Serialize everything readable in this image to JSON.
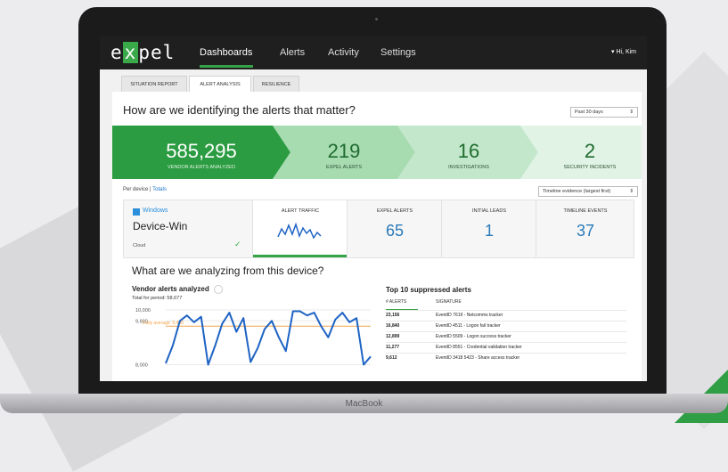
{
  "laptop_label": "MacBook",
  "app": {
    "logo_pre": "e",
    "logo_x": "x",
    "logo_post": "pel",
    "nav": [
      "Dashboards",
      "Alerts",
      "Activity",
      "Settings"
    ],
    "user": "▾ Hi, Kim"
  },
  "tabs": [
    "SITUATION REPORT",
    "ALERT ANALYSIS",
    "RESILIENCE"
  ],
  "question1": "How are we identifying the alerts that matter?",
  "range_select": "Past 30 days",
  "funnel": [
    {
      "value": "585,295",
      "label": "Vendor alerts analyzed"
    },
    {
      "value": "219",
      "label": "Expel alerts"
    },
    {
      "value": "16",
      "label": "Investigations"
    },
    {
      "value": "2",
      "label": "Security incidents"
    }
  ],
  "per_device": "Per device",
  "totals_link": "Totals",
  "sort_select": "Timeline evidence (largest first)",
  "device": {
    "brand": "Windows",
    "name": "Device-Win",
    "cloud": "Cloud",
    "columns": [
      {
        "label": "Alert traffic",
        "value": ""
      },
      {
        "label": "Expel alerts",
        "value": "65"
      },
      {
        "label": "Initial leads",
        "value": "1"
      },
      {
        "label": "Timeline events",
        "value": "37"
      }
    ]
  },
  "question2": "What are we analyzing from this device?",
  "chart_title": "Vendor alerts analyzed",
  "chart_subtitle": "Total for period: 58,677",
  "chart_data": {
    "type": "line",
    "title": "Vendor alerts analyzed",
    "subtitle": "Total for period: 58,677",
    "yticks": [
      "10,000",
      "9,600",
      "8,000"
    ],
    "ylim": [
      7400,
      10000
    ],
    "annotation": "Daily average: 9,408",
    "average": 9408,
    "values": [
      8050,
      8700,
      9600,
      9800,
      9550,
      9750,
      8000,
      8700,
      9500,
      9900,
      9200,
      9700,
      8100,
      8600,
      9300,
      9600,
      9000,
      8500,
      9950,
      9950,
      9800,
      9900,
      9400,
      9000,
      9650,
      9900,
      9550,
      9700,
      8000,
      8300
    ],
    "colors": {
      "line": "#1e63c4",
      "average": "#f0a44a"
    }
  },
  "top10": {
    "title": "Top 10 suppressed alerts",
    "headers": [
      "# Alerts",
      "Signature"
    ],
    "rows": [
      [
        "23,156",
        "EventID 7619 - Netcomms tracker"
      ],
      [
        "16,840",
        "EventID 4511 - Logon fail tracker"
      ],
      [
        "12,899",
        "EventID 5509 - Logon success tracker"
      ],
      [
        "11,277",
        "EventID 8551 - Credential validation tracker"
      ],
      [
        "9,612",
        "EventID 3418 5423 - Share access tracker"
      ]
    ]
  }
}
